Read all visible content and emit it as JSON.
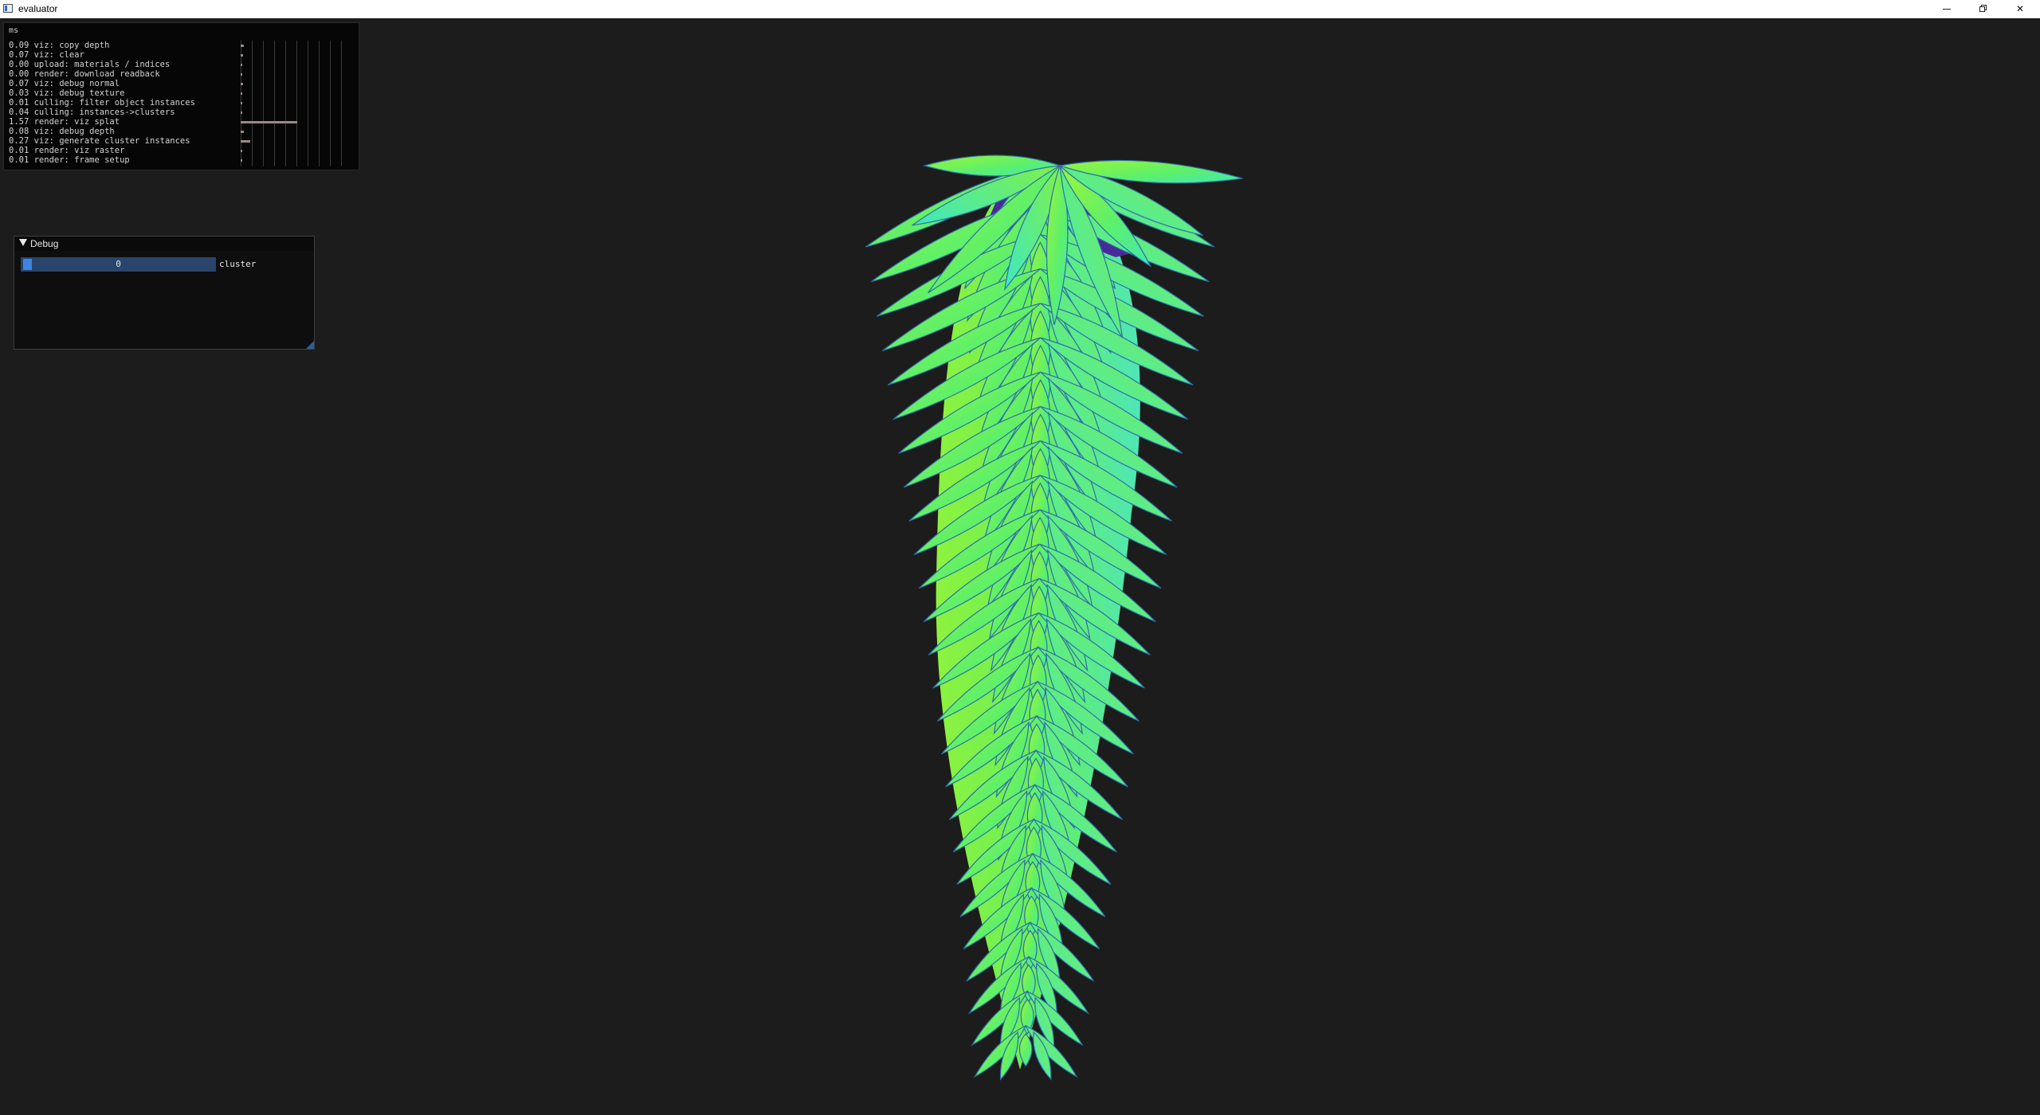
{
  "window": {
    "title": "evaluator"
  },
  "profiler": {
    "unit_label": "ms",
    "rows": [
      "0.09 viz: copy depth",
      "0.07 viz: clear",
      "0.00 upload: materials / indices",
      "0.00 render: download readback",
      "0.07 viz: debug normal",
      "0.03 viz: debug texture",
      "0.01 culling: filter object instances",
      "0.04 culling: instances->clusters",
      "1.57 render: viz splat",
      "0.08 viz: debug depth",
      "0.27 viz: generate cluster instances",
      "0.01 render: viz raster",
      "0.01 render: frame setup"
    ],
    "bar_ms": [
      0.09,
      0.07,
      0.0,
      0.0,
      0.07,
      0.03,
      0.01,
      0.04,
      1.57,
      0.08,
      0.27,
      0.01,
      0.01
    ]
  },
  "debug": {
    "title": "Debug",
    "slider_value": "0",
    "slider_label": "cluster"
  },
  "colors": {
    "background": "#1c1c1c",
    "slider_fill": "#29456b",
    "slider_grab": "#3d85e0",
    "leaf_green": "#7df03a",
    "leaf_cyan": "#4ff0b0"
  }
}
